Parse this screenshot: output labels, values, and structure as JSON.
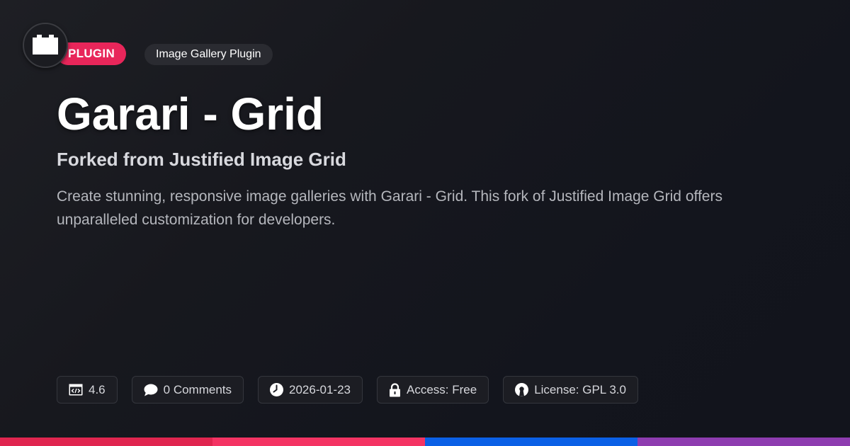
{
  "logo": {
    "icon": "plugin-block-icon"
  },
  "badges": {
    "kind": "PLUGIN",
    "category": "Image Gallery Plugin"
  },
  "title": "Garari - Grid",
  "subtitle": "Forked from Justified Image Grid",
  "description": "Create stunning, responsive image galleries with Garari - Grid. This fork of Justified Image Grid offers unparalleled customization for developers.",
  "meta": {
    "version": "4.6",
    "comments": "0 Comments",
    "date": "2026-01-23",
    "access": "Access: Free",
    "license": "License: GPL 3.0"
  },
  "colors": {
    "accent": "#e8265a",
    "bar": [
      "#e0254f",
      "#f43363",
      "#0b60e6",
      "#8e3cb0"
    ]
  }
}
